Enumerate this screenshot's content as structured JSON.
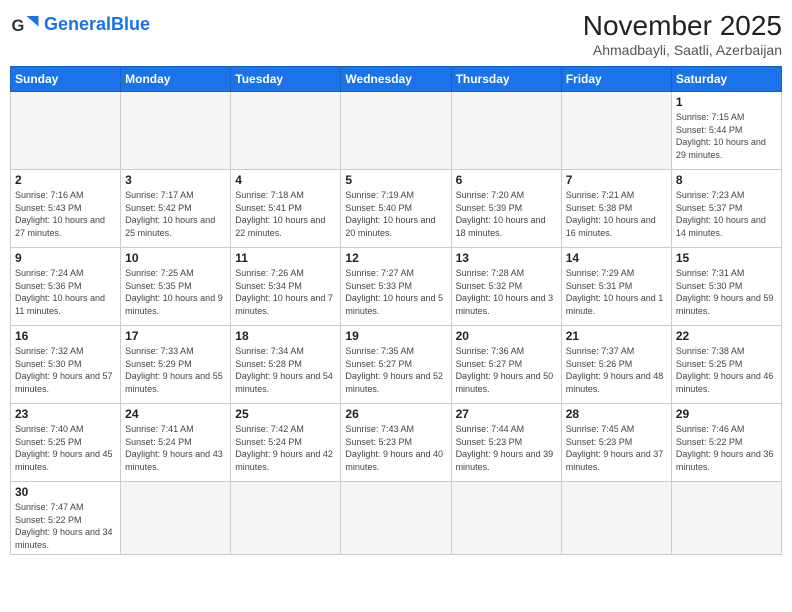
{
  "header": {
    "logo_general": "General",
    "logo_blue": "Blue",
    "month_title": "November 2025",
    "subtitle": "Ahmadbayli, Saatli, Azerbaijan"
  },
  "weekdays": [
    "Sunday",
    "Monday",
    "Tuesday",
    "Wednesday",
    "Thursday",
    "Friday",
    "Saturday"
  ],
  "weeks": [
    [
      {
        "day": "",
        "info": ""
      },
      {
        "day": "",
        "info": ""
      },
      {
        "day": "",
        "info": ""
      },
      {
        "day": "",
        "info": ""
      },
      {
        "day": "",
        "info": ""
      },
      {
        "day": "",
        "info": ""
      },
      {
        "day": "1",
        "info": "Sunrise: 7:15 AM\nSunset: 5:44 PM\nDaylight: 10 hours\nand 29 minutes."
      }
    ],
    [
      {
        "day": "2",
        "info": "Sunrise: 7:16 AM\nSunset: 5:43 PM\nDaylight: 10 hours\nand 27 minutes."
      },
      {
        "day": "3",
        "info": "Sunrise: 7:17 AM\nSunset: 5:42 PM\nDaylight: 10 hours\nand 25 minutes."
      },
      {
        "day": "4",
        "info": "Sunrise: 7:18 AM\nSunset: 5:41 PM\nDaylight: 10 hours\nand 22 minutes."
      },
      {
        "day": "5",
        "info": "Sunrise: 7:19 AM\nSunset: 5:40 PM\nDaylight: 10 hours\nand 20 minutes."
      },
      {
        "day": "6",
        "info": "Sunrise: 7:20 AM\nSunset: 5:39 PM\nDaylight: 10 hours\nand 18 minutes."
      },
      {
        "day": "7",
        "info": "Sunrise: 7:21 AM\nSunset: 5:38 PM\nDaylight: 10 hours\nand 16 minutes."
      },
      {
        "day": "8",
        "info": "Sunrise: 7:23 AM\nSunset: 5:37 PM\nDaylight: 10 hours\nand 14 minutes."
      }
    ],
    [
      {
        "day": "9",
        "info": "Sunrise: 7:24 AM\nSunset: 5:36 PM\nDaylight: 10 hours\nand 11 minutes."
      },
      {
        "day": "10",
        "info": "Sunrise: 7:25 AM\nSunset: 5:35 PM\nDaylight: 10 hours\nand 9 minutes."
      },
      {
        "day": "11",
        "info": "Sunrise: 7:26 AM\nSunset: 5:34 PM\nDaylight: 10 hours\nand 7 minutes."
      },
      {
        "day": "12",
        "info": "Sunrise: 7:27 AM\nSunset: 5:33 PM\nDaylight: 10 hours\nand 5 minutes."
      },
      {
        "day": "13",
        "info": "Sunrise: 7:28 AM\nSunset: 5:32 PM\nDaylight: 10 hours\nand 3 minutes."
      },
      {
        "day": "14",
        "info": "Sunrise: 7:29 AM\nSunset: 5:31 PM\nDaylight: 10 hours\nand 1 minute."
      },
      {
        "day": "15",
        "info": "Sunrise: 7:31 AM\nSunset: 5:30 PM\nDaylight: 9 hours\nand 59 minutes."
      }
    ],
    [
      {
        "day": "16",
        "info": "Sunrise: 7:32 AM\nSunset: 5:30 PM\nDaylight: 9 hours\nand 57 minutes."
      },
      {
        "day": "17",
        "info": "Sunrise: 7:33 AM\nSunset: 5:29 PM\nDaylight: 9 hours\nand 55 minutes."
      },
      {
        "day": "18",
        "info": "Sunrise: 7:34 AM\nSunset: 5:28 PM\nDaylight: 9 hours\nand 54 minutes."
      },
      {
        "day": "19",
        "info": "Sunrise: 7:35 AM\nSunset: 5:27 PM\nDaylight: 9 hours\nand 52 minutes."
      },
      {
        "day": "20",
        "info": "Sunrise: 7:36 AM\nSunset: 5:27 PM\nDaylight: 9 hours\nand 50 minutes."
      },
      {
        "day": "21",
        "info": "Sunrise: 7:37 AM\nSunset: 5:26 PM\nDaylight: 9 hours\nand 48 minutes."
      },
      {
        "day": "22",
        "info": "Sunrise: 7:38 AM\nSunset: 5:25 PM\nDaylight: 9 hours\nand 46 minutes."
      }
    ],
    [
      {
        "day": "23",
        "info": "Sunrise: 7:40 AM\nSunset: 5:25 PM\nDaylight: 9 hours\nand 45 minutes."
      },
      {
        "day": "24",
        "info": "Sunrise: 7:41 AM\nSunset: 5:24 PM\nDaylight: 9 hours\nand 43 minutes."
      },
      {
        "day": "25",
        "info": "Sunrise: 7:42 AM\nSunset: 5:24 PM\nDaylight: 9 hours\nand 42 minutes."
      },
      {
        "day": "26",
        "info": "Sunrise: 7:43 AM\nSunset: 5:23 PM\nDaylight: 9 hours\nand 40 minutes."
      },
      {
        "day": "27",
        "info": "Sunrise: 7:44 AM\nSunset: 5:23 PM\nDaylight: 9 hours\nand 39 minutes."
      },
      {
        "day": "28",
        "info": "Sunrise: 7:45 AM\nSunset: 5:23 PM\nDaylight: 9 hours\nand 37 minutes."
      },
      {
        "day": "29",
        "info": "Sunrise: 7:46 AM\nSunset: 5:22 PM\nDaylight: 9 hours\nand 36 minutes."
      }
    ],
    [
      {
        "day": "30",
        "info": "Sunrise: 7:47 AM\nSunset: 5:22 PM\nDaylight: 9 hours\nand 34 minutes."
      },
      {
        "day": "",
        "info": ""
      },
      {
        "day": "",
        "info": ""
      },
      {
        "day": "",
        "info": ""
      },
      {
        "day": "",
        "info": ""
      },
      {
        "day": "",
        "info": ""
      },
      {
        "day": "",
        "info": ""
      }
    ]
  ]
}
